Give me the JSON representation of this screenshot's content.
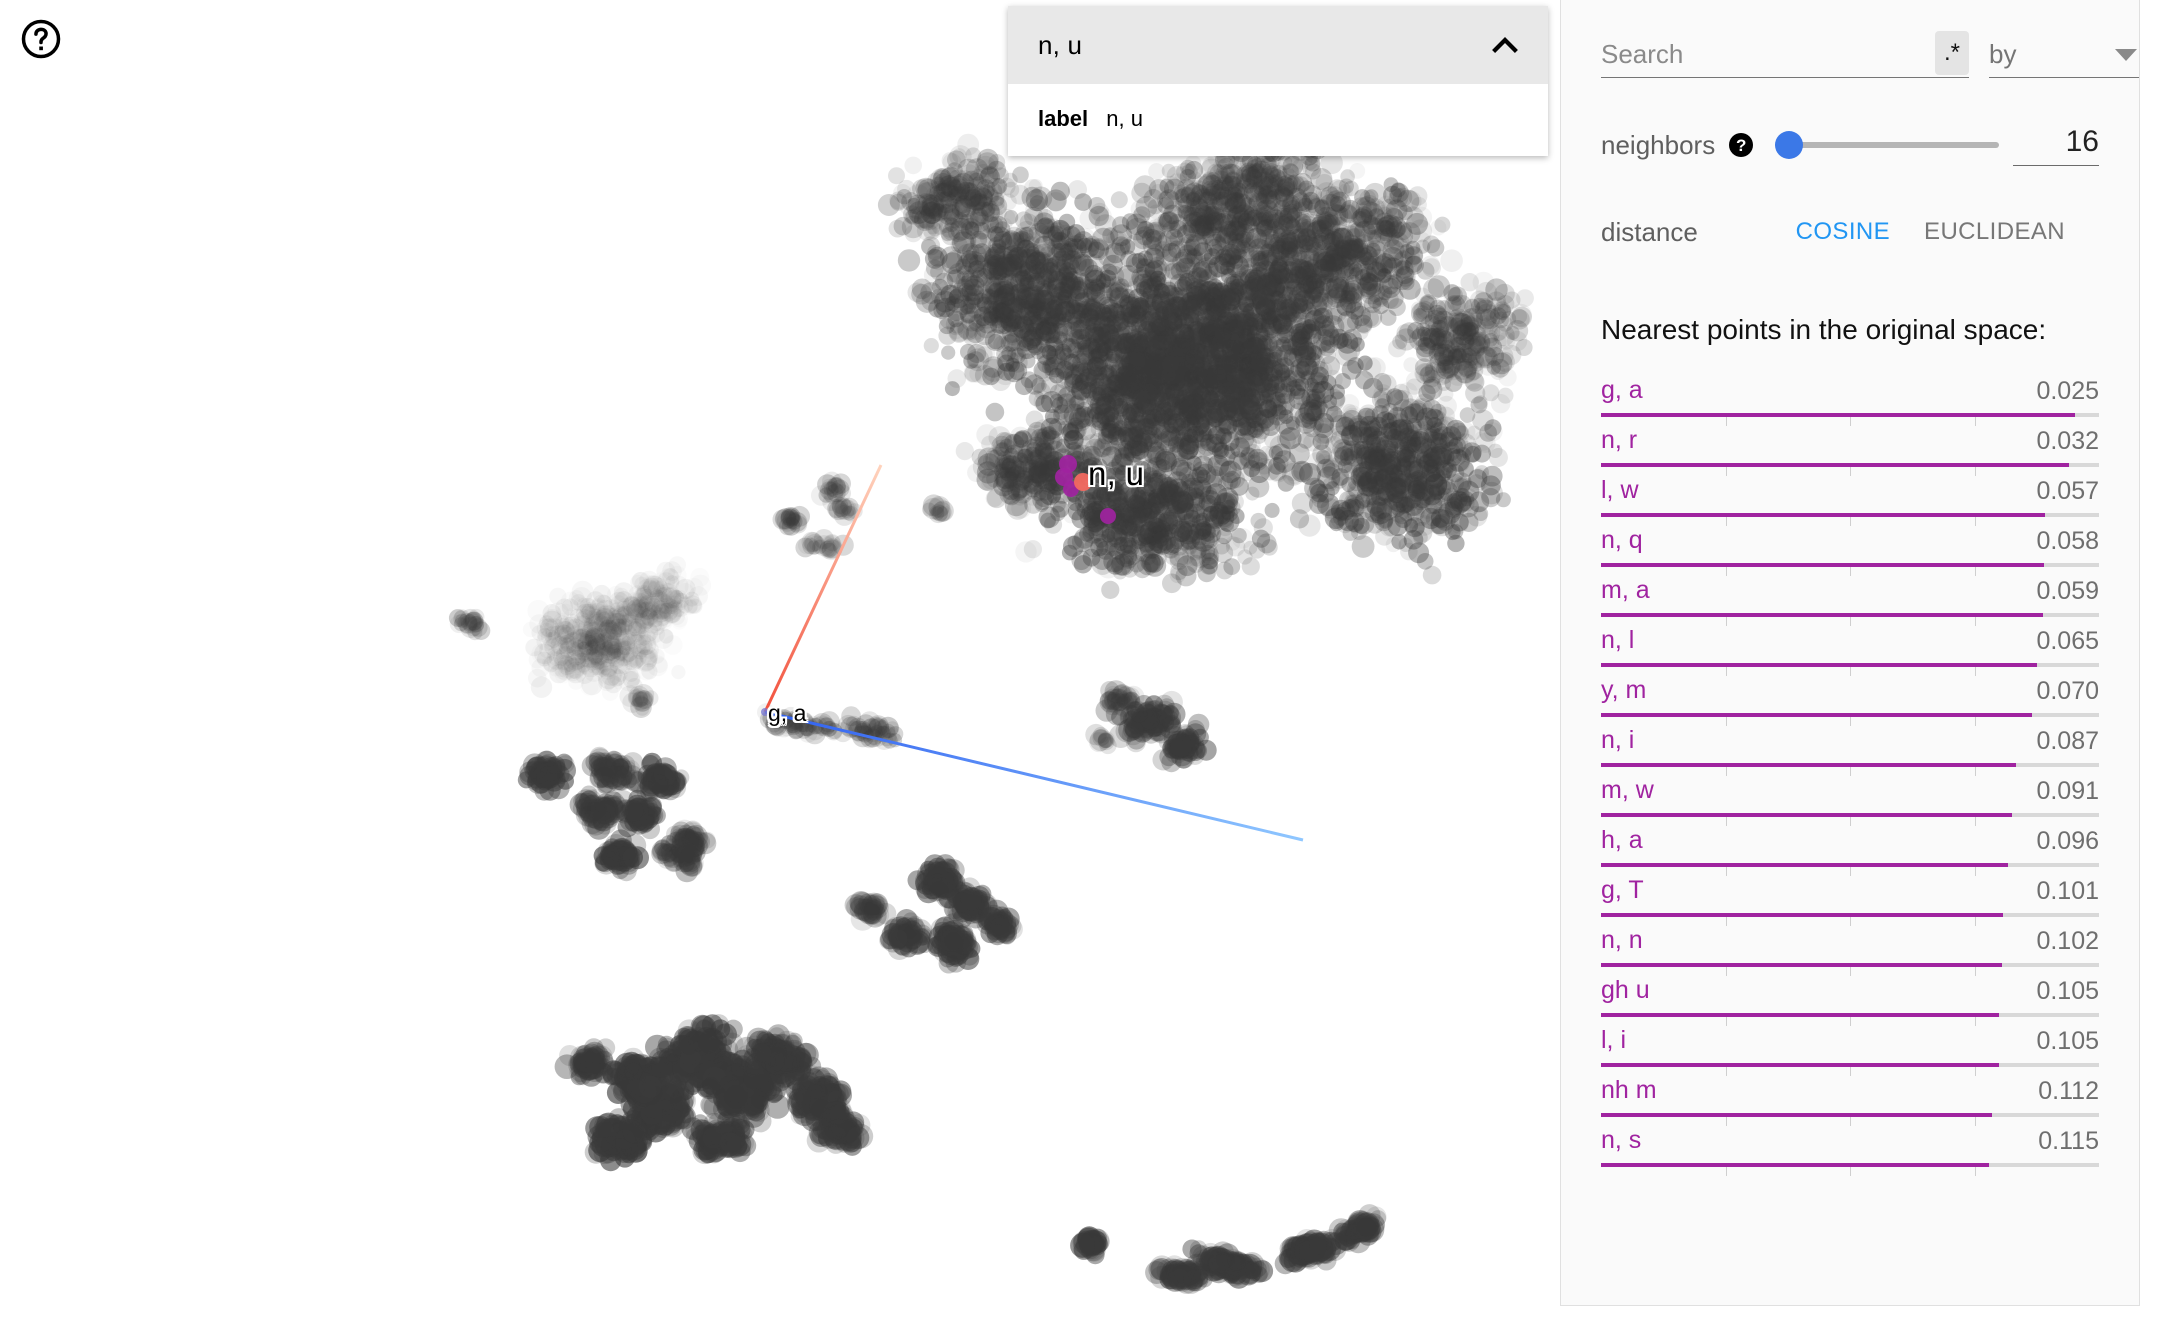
{
  "app": {
    "help_icon": "help-circle-icon"
  },
  "metadata_card": {
    "title": "n, u",
    "collapse_icon": "chevron-up-icon",
    "fields": [
      {
        "key": "label",
        "value": "n, u"
      }
    ]
  },
  "canvas": {
    "selected_point_label": "n, u",
    "origin_point_label": "g, a",
    "axes": [
      {
        "name": "x-axis",
        "color": "#f4836e"
      },
      {
        "name": "y-axis",
        "color": "#5fe017"
      },
      {
        "name": "z-axis",
        "color": "#3b6ef5"
      }
    ],
    "colors": {
      "selected_point": "#f2685f",
      "neighbor_point": "#a023a0",
      "cloud_point": "#3c3c3c"
    }
  },
  "inspector": {
    "search": {
      "placeholder": "Search",
      "value": "",
      "regex_label": ".*",
      "by_label": "by",
      "caret_icon": "chevron-down-icon"
    },
    "neighbors": {
      "label": "neighbors",
      "help_icon": "question-mark-icon",
      "value": "16",
      "slider_percent": 0
    },
    "distance": {
      "label": "distance",
      "options": [
        {
          "label": "COSINE",
          "active": true
        },
        {
          "label": "EUCLIDEAN",
          "active": false
        }
      ]
    },
    "nearest": {
      "title": "Nearest points in the original space:",
      "max_value": 0.115,
      "items": [
        {
          "label": "g, a",
          "value": "0.025",
          "num": 0.025
        },
        {
          "label": "n, r",
          "value": "0.032",
          "num": 0.032
        },
        {
          "label": "l, w",
          "value": "0.057",
          "num": 0.057
        },
        {
          "label": "n, q",
          "value": "0.058",
          "num": 0.058
        },
        {
          "label": "m, a",
          "value": "0.059",
          "num": 0.059
        },
        {
          "label": "n, l",
          "value": "0.065",
          "num": 0.065
        },
        {
          "label": "y, m",
          "value": "0.070",
          "num": 0.07
        },
        {
          "label": "n, i",
          "value": "0.087",
          "num": 0.087
        },
        {
          "label": "m, w",
          "value": "0.091",
          "num": 0.091
        },
        {
          "label": "h, a",
          "value": "0.096",
          "num": 0.096
        },
        {
          "label": "g, T",
          "value": "0.101",
          "num": 0.101
        },
        {
          "label": "n, n",
          "value": "0.102",
          "num": 0.102
        },
        {
          "label": "gh u",
          "value": "0.105",
          "num": 0.105
        },
        {
          "label": "l, i",
          "value": "0.105",
          "num": 0.105
        },
        {
          "label": "nh m",
          "value": "0.112",
          "num": 0.112
        },
        {
          "label": "n, s",
          "value": "0.115",
          "num": 0.115
        }
      ]
    }
  }
}
